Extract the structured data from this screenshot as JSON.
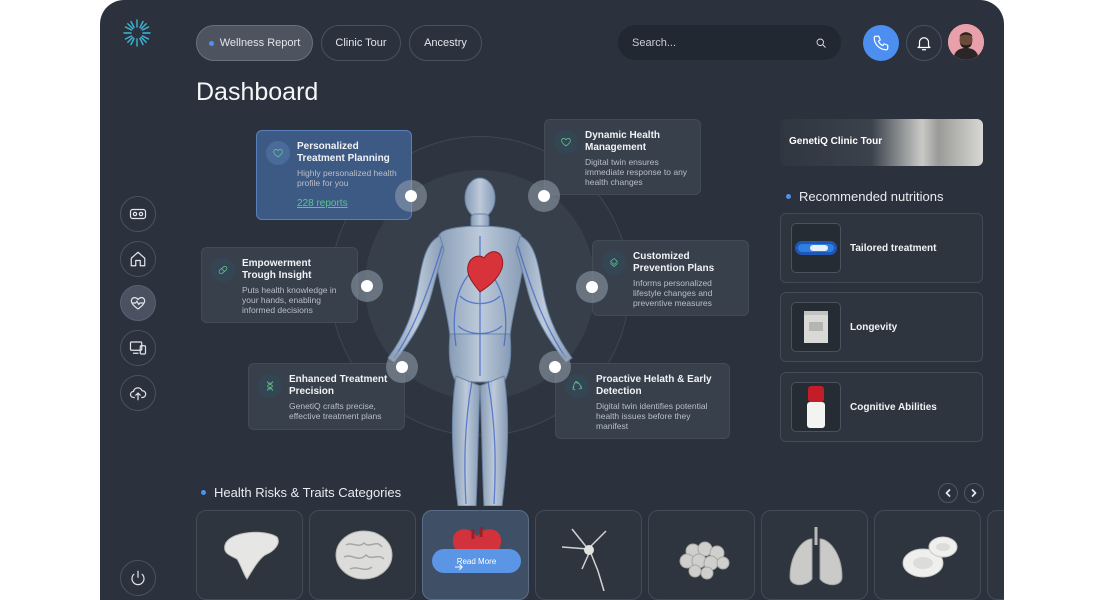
{
  "header": {
    "tabs": [
      {
        "label": "Wellness Report",
        "active": true
      },
      {
        "label": "Clinic Tour",
        "active": false
      },
      {
        "label": "Ancestry",
        "active": false
      }
    ],
    "search_placeholder": "Search..."
  },
  "page_title": "Dashboard",
  "sidebar": {
    "items": [
      "vr-headset-icon",
      "home-icon",
      "heart-pulse-icon",
      "devices-icon",
      "cloud-upload-icon"
    ],
    "active_index": 2,
    "bottom": "power-icon"
  },
  "features": {
    "planning": {
      "title": "Personalized Treatment Planning",
      "desc": "Highly personalized health profile for you",
      "link": "228 reports",
      "icon": "heart-icon"
    },
    "dynamic": {
      "title": "Dynamic Health Management",
      "desc": "Digital twin ensures immediate response to any health changes",
      "icon": "heart-icon"
    },
    "empowerment": {
      "title": "Empowerment Trough Insight",
      "desc": "Puts health knowledge in your hands, enabling informed decisions",
      "icon": "pill-icon"
    },
    "prevention": {
      "title": "Customized Prevention Plans",
      "desc": "Informs personalized lifestyle changes and preventive measures",
      "icon": "layers-icon"
    },
    "precision": {
      "title": "Enhanced Treatment Precision",
      "desc": "GenetiQ crafts precise, effective treatment plans",
      "icon": "dna-icon"
    },
    "proactive": {
      "title": "Proactive Helath & Early Detection",
      "desc": "Digital twin identifies potential health issues before they manifest",
      "icon": "recycle-icon"
    }
  },
  "clinic_tour": {
    "label": "GenetiQ Clinic Tour"
  },
  "nutritions": {
    "heading": "Recommended nutritions",
    "items": [
      {
        "label": "Tailored treatment"
      },
      {
        "label": "Longevity"
      },
      {
        "label": "Cognitive Abilities"
      }
    ]
  },
  "categories": {
    "heading": "Health Risks & Traits Categories",
    "items": [
      "liver",
      "brain",
      "heart",
      "neuron",
      "cells",
      "lungs",
      "blood-cells"
    ],
    "active_index": 2,
    "read_more": "Read More"
  },
  "colors": {
    "accent": "#4c8ff0",
    "green": "#5cc48b",
    "panel": "#2b323d"
  }
}
